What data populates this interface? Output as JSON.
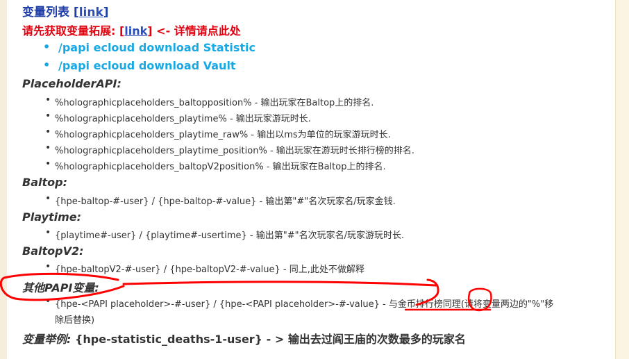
{
  "header": {
    "title": "变量列表",
    "link_label": "link"
  },
  "notice": {
    "prefix": "请先获取变量拓展: [",
    "link_label": "link",
    "suffix": "] <- 详情请点此处"
  },
  "commands": [
    "/papi ecloud download Statistic",
    "/papi ecloud download Vault"
  ],
  "sections": {
    "placeholderapi": {
      "title": "PlaceholderAPI:",
      "items": [
        "%holographicplaceholders_baltopposition% - 输出玩家在Baltop上的排名.",
        "%holographicplaceholders_playtime% - 输出玩家游玩时长.",
        "%holographicplaceholders_playtime_raw% - 输出以ms为单位的玩家游玩时长.",
        "%holographicplaceholders_playtime_position% - 输出玩家在游玩时长排行榜的排名.",
        "%holographicplaceholders_baltopV2position%  - 输出玩家在Baltop上的排名."
      ]
    },
    "baltop": {
      "title": "Baltop:",
      "items": [
        "{hpe-baltop-#-user} / {hpe-baltop-#-value} - 输出第\"#\"名次玩家名/玩家金钱."
      ]
    },
    "playtime": {
      "title": "Playtime:",
      "items": [
        "{playtime#-user} / {playtime#-usertime} - 输出第\"#\"名次玩家名/玩家游玩时长."
      ]
    },
    "baltopv2": {
      "title": "BaltopV2:",
      "items": [
        "{hpe-baltopV2-#-user} / {hpe-baltopV2-#-value} - 同上,此处不做解释"
      ]
    },
    "other": {
      "title": "其他PAPI变量:",
      "item_line1": "{hpe-<PAPI placeholder>-#-user} / {hpe-<PAPI placeholder>-#-value} - 与金币排行榜同理(请将变量两边的\"%\"移",
      "item_line2": "除后替换)"
    }
  },
  "example": {
    "label": "变量举例:",
    "text": " {hpe-statistic_deaths-1-user} - > 输出去过阎王庙的次数最多的玩家名"
  },
  "colors": {
    "title_blue": "#1e3ea8",
    "notice_red": "#e0000f",
    "command_cyan": "#18a9e5",
    "annotation_red": "#ff0000"
  }
}
